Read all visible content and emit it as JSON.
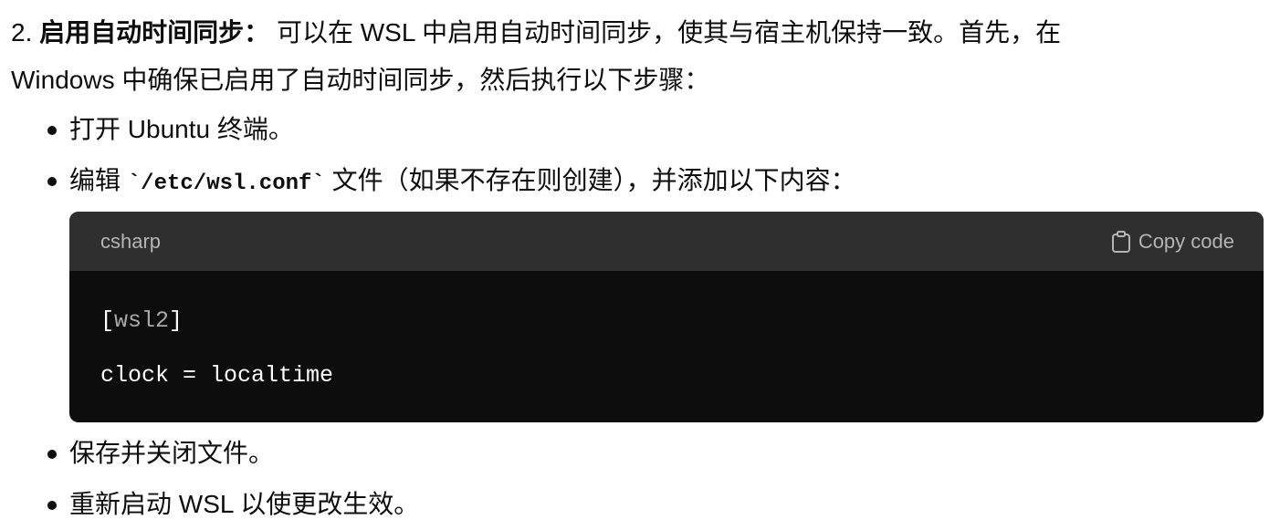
{
  "step": {
    "number": "2.",
    "title": "启用自动时间同步：",
    "text_line1": "可以在 WSL 中启用自动时间同步，使其与宿主机保持一致。首先，在",
    "text_line2": "Windows 中确保已启用了自动时间同步，然后执行以下步骤："
  },
  "bullets": [
    {
      "text": "打开 Ubuntu 终端。"
    },
    {
      "before": "编辑 ",
      "code": "`/etc/wsl.conf`",
      "after": " 文件（如果不存在则创建），并添加以下内容："
    },
    {
      "text": "保存并关闭文件。"
    },
    {
      "text": "重新启动 WSL 以使更改生效。"
    }
  ],
  "code_block": {
    "language": "csharp",
    "copy_label": "Copy code",
    "copy_icon": "clipboard-icon",
    "line1_open": "[",
    "line1_section": "wsl2",
    "line1_close": "]",
    "line2": "clock = localtime"
  },
  "colors": {
    "text": "#0d0d0d",
    "code_bg": "#0d0d0d",
    "code_header_bg": "#2f2f2f",
    "code_header_text": "#b4b4b4",
    "code_section": "#a9a9a9"
  }
}
